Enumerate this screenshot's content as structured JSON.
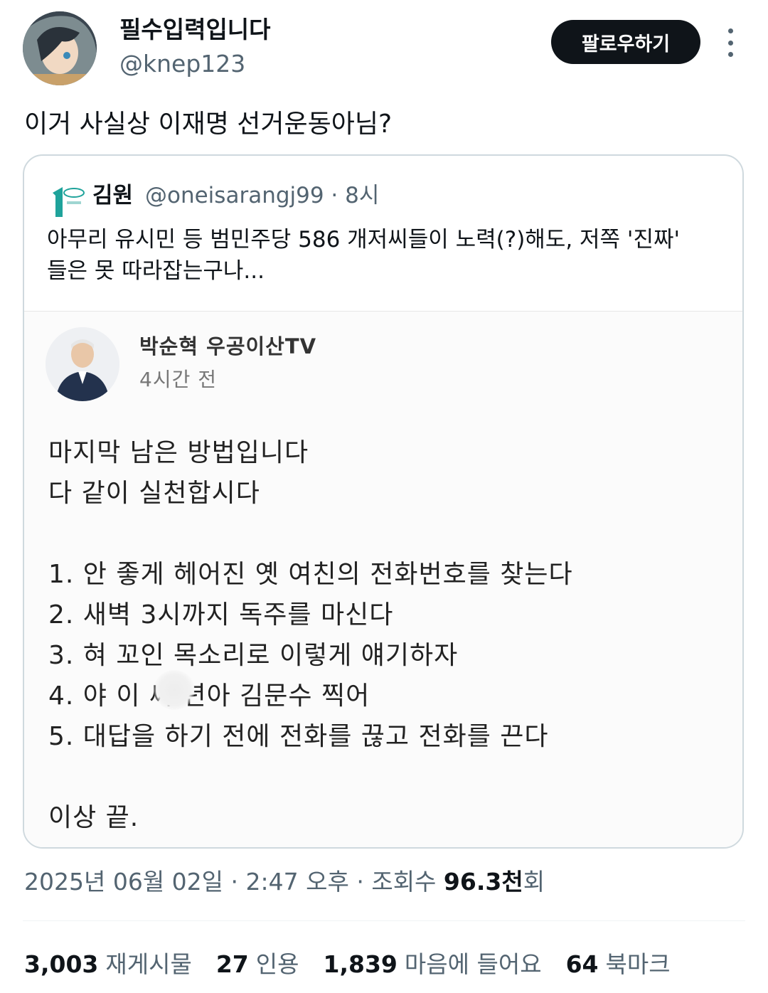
{
  "author": {
    "display_name": "필수입력입니다",
    "handle": "@knep123",
    "follow_label": "팔로우하기"
  },
  "tweet": {
    "text": "이거 사실상 이재명 선거운동아님?"
  },
  "quote": {
    "name": "김원",
    "handle_time": "@oneisarangj99 · 8시",
    "text_lines": [
      "아무리 유시민 등 범민주당 586 개저씨들이 노력(?)해도, 저쪽 '진짜'",
      "들은 못 따라잡는구나..."
    ],
    "image": {
      "poster_name": "박순혁 우공이산TV",
      "poster_time": "4시간 전",
      "body_lines": [
        "마지막 남은 방법입니다",
        "다 같이 실천합시다",
        "",
        "1. 안 좋게 헤어진 옛 여친의 전화번호를 찾는다",
        "2. 새벽 3시까지 독주를 마신다",
        "3. 혀 꼬인 목소리로 이렇게 얘기하자",
        "4. 야 이 씨  년아 김문수 찍어",
        "5. 대답을 하기 전에 전화를 끊고 전화를 끈다",
        "",
        "이상 끝."
      ]
    }
  },
  "meta": {
    "date": "2025년 06월 02일",
    "time": "2:47 오후",
    "views_label": "조회수",
    "views_value": "96.3천",
    "views_suffix": "회"
  },
  "stats": [
    {
      "value": "3,003",
      "label": "재게시물"
    },
    {
      "value": "27",
      "label": "인용"
    },
    {
      "value": "1,839",
      "label": "마음에 들어요"
    },
    {
      "value": "64",
      "label": "북마크"
    }
  ],
  "colors": {
    "text_primary": "#0f1419",
    "text_secondary": "#536471",
    "border": "#cfd9de",
    "quote_logo": "#1fa39b"
  }
}
